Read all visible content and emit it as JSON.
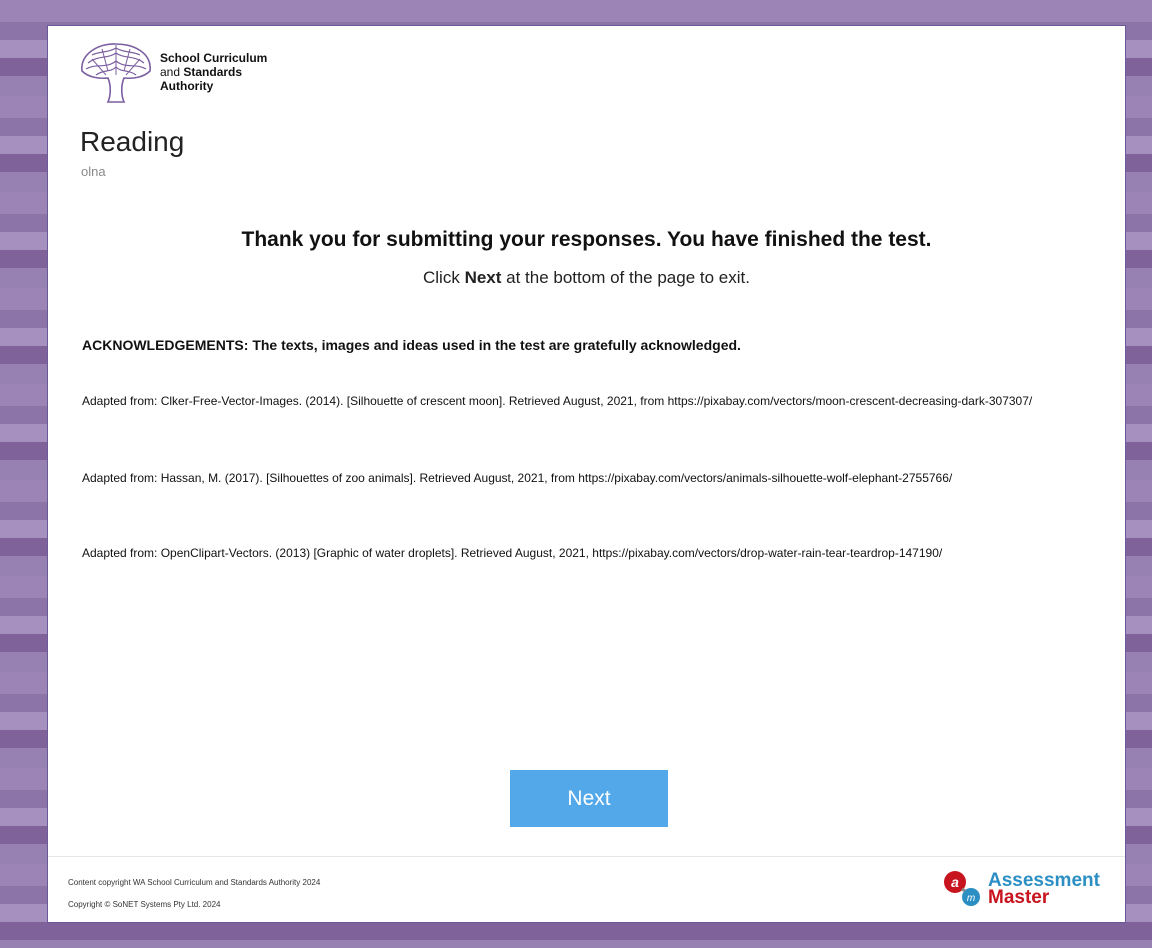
{
  "header": {
    "logo_line1": "School Curriculum",
    "logo_line2_pre": "and ",
    "logo_line2_bold": "Standards",
    "logo_line3": "Authority",
    "title": "Reading",
    "subtitle": "olna"
  },
  "main": {
    "thanks": "Thank you for submitting your responses. You have finished the test.",
    "instr_pre": "Click ",
    "instr_bold": "Next",
    "instr_post": " at the bottom of the page to exit.",
    "ack_heading": "ACKNOWLEDGEMENTS: The texts, images and ideas used in the test are gratefully acknowledged.",
    "references": [
      "Adapted from: Clker-Free-Vector-Images. (2014). [Silhouette of crescent moon]. Retrieved August, 2021, from https://pixabay.com/vectors/moon-crescent-decreasing-dark-307307/",
      "Adapted from: Hassan, M. (2017). [Silhouettes of zoo animals]. Retrieved August, 2021, from https://pixabay.com/vectors/animals-silhouette-wolf-elephant-2755766/",
      "Adapted from: OpenClipart-Vectors. (2013) [Graphic of water droplets]. Retrieved August, 2021, https://pixabay.com/vectors/drop-water-rain-tear-teardrop-147190/"
    ],
    "next_label": "Next"
  },
  "footer": {
    "copyright1": "Content copyright WA School Curriculum and Standards Authority 2024",
    "copyright2": "Copyright © SoNET Systems Pty Ltd. 2024",
    "brand_line1": "Assessment",
    "brand_line2": "Master"
  },
  "colors": {
    "button": "#53a8ea",
    "brand_blue": "#2c8fc4",
    "brand_red": "#c8141e",
    "logo_purple": "#7b5fa0"
  }
}
